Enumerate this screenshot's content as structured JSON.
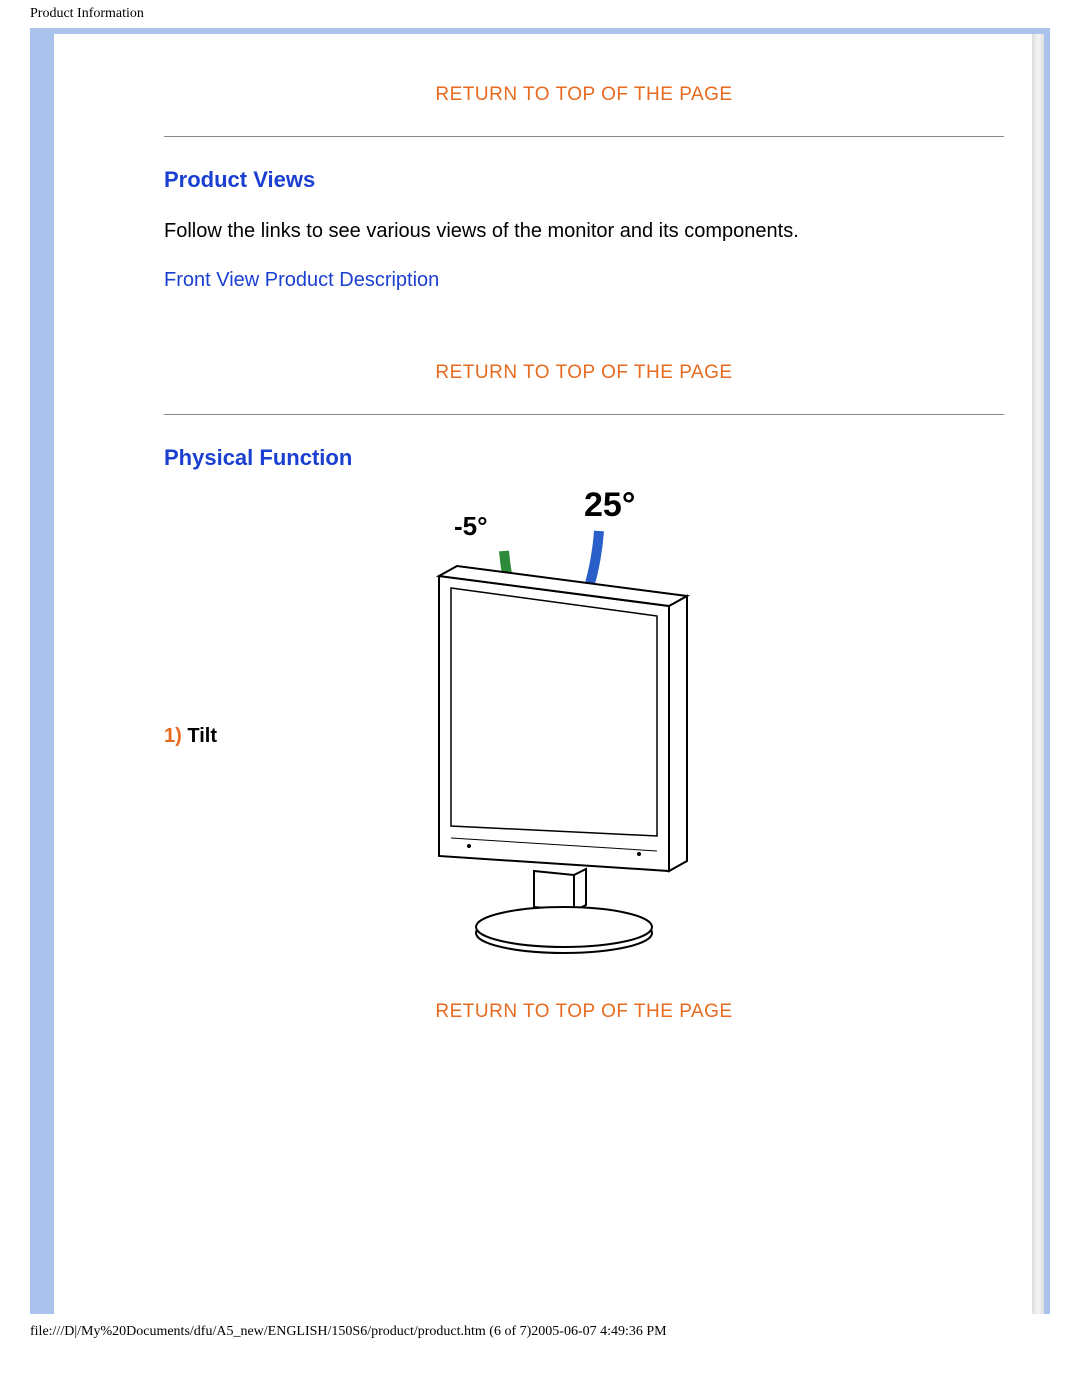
{
  "header": {
    "title": "Product Information"
  },
  "links": {
    "return_to_top": "RETURN TO TOP OF THE PAGE",
    "front_view": "Front View Product Description"
  },
  "sections": {
    "product_views": {
      "heading": "Product Views",
      "body": "Follow the links to see various views of the monitor and its components."
    },
    "physical_function": {
      "heading": "Physical Function",
      "tilt_num": "1)",
      "tilt_label": " Tilt",
      "angle_neg": "-5°",
      "angle_pos": "25°"
    }
  },
  "footer": {
    "path": "file:///D|/My%20Documents/dfu/A5_new/ENGLISH/150S6/product/product.htm (6 of 7)2005-06-07 4:49:36 PM"
  }
}
